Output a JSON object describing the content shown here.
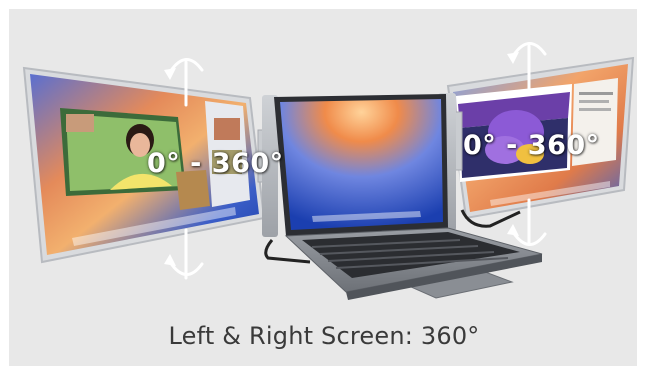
{
  "left_screen": {
    "rotation_label": "0° - 360°"
  },
  "right_screen": {
    "rotation_label": "0° - 360°"
  },
  "caption": "Left & Right Screen: 360°",
  "icons": [
    "rotate-arrow-icon",
    "laptop",
    "monitor",
    "dock"
  ],
  "colors": {
    "background": "#e8e8e8",
    "caption_text": "#3a3a3a",
    "label_text": "#ffffff"
  }
}
